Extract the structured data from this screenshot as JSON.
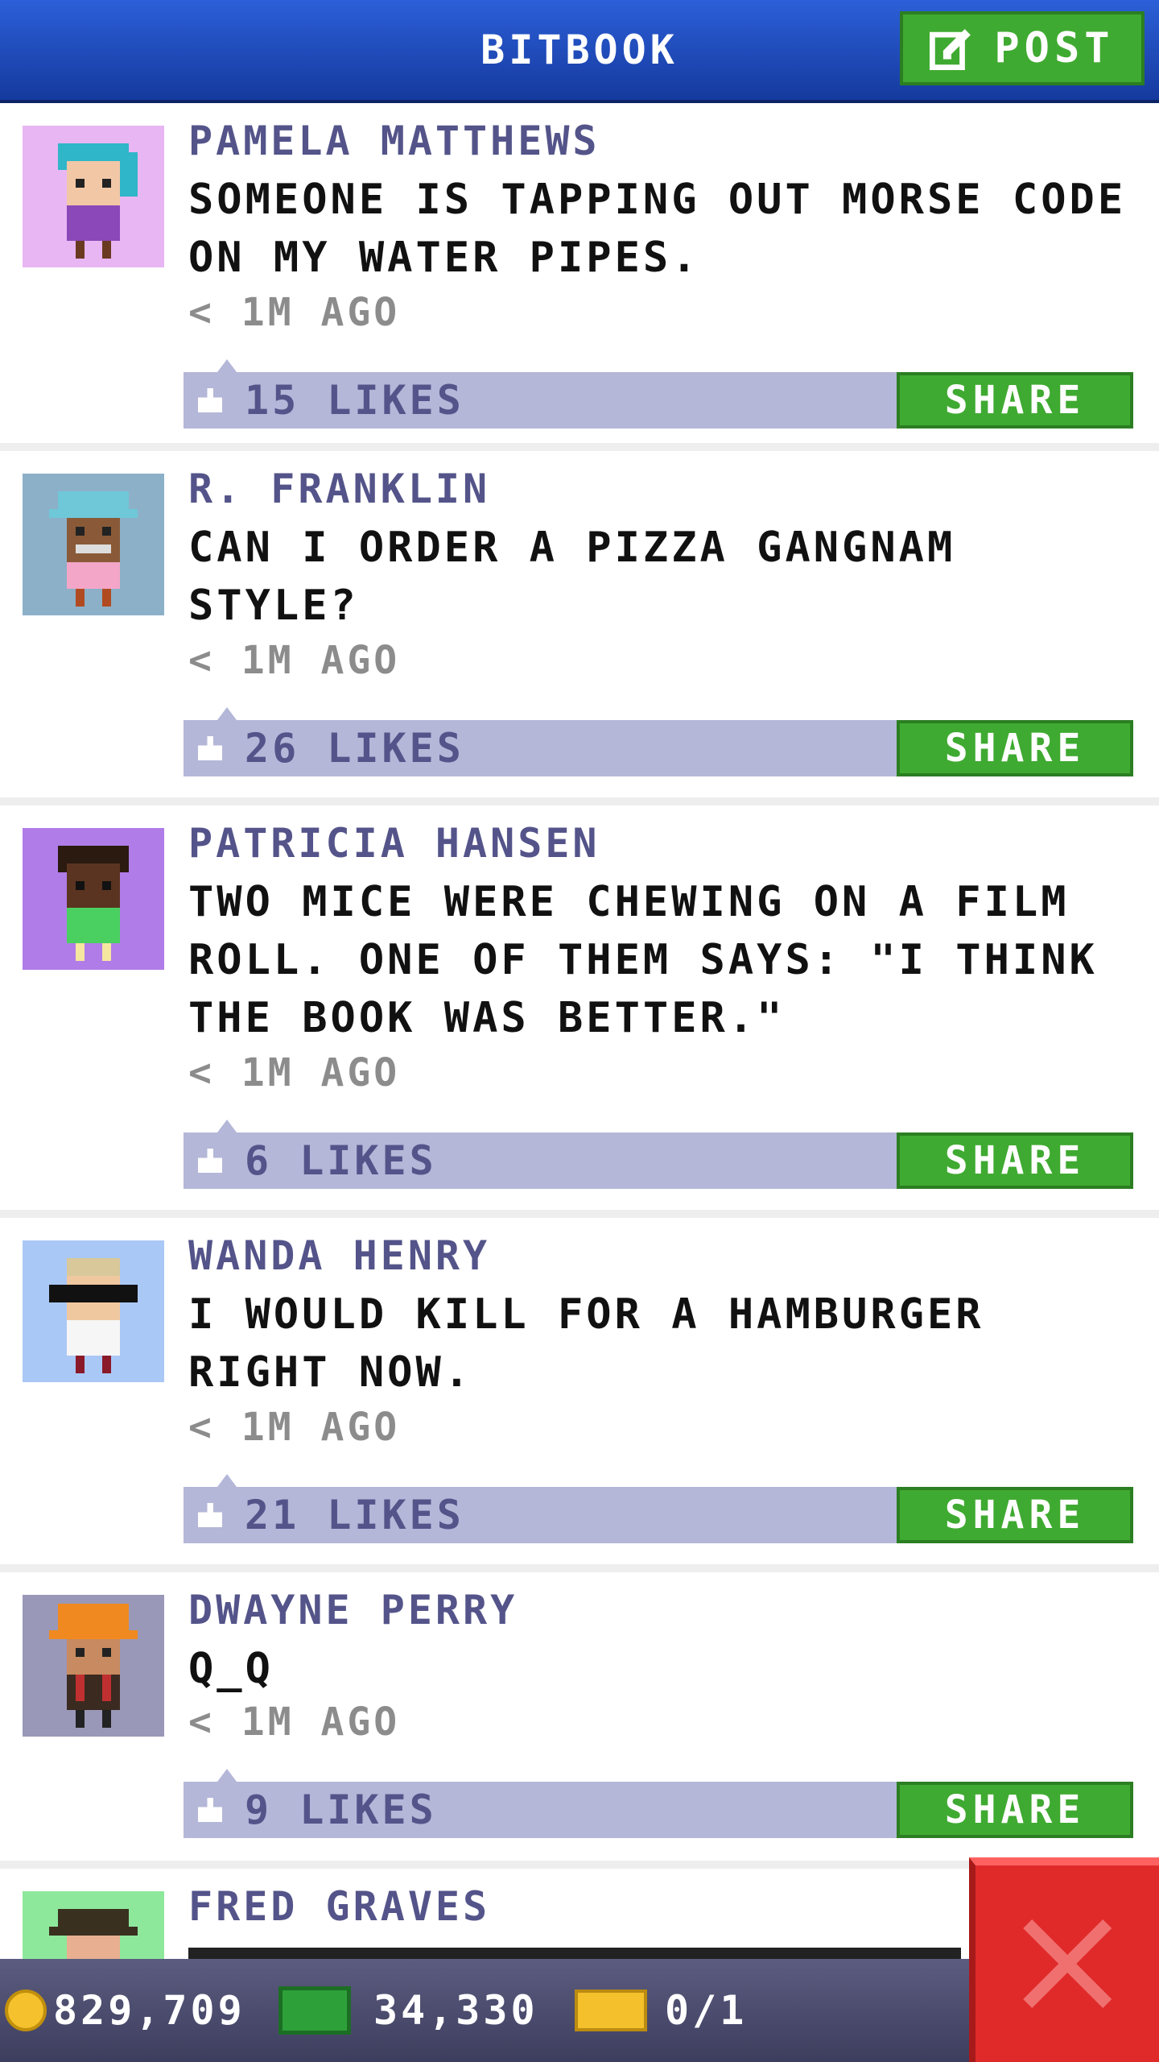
{
  "header": {
    "title": "BITBOOK",
    "post_label": "POST"
  },
  "share_label": "SHARE",
  "posts": [
    {
      "name": "PAMELA MATTHEWS",
      "text": "SOMEONE IS TAPPING OUT MORSE CODE ON MY WATER PIPES.",
      "time": "< 1M AGO",
      "likes": "15 LIKES",
      "avatar_bg": "#e8b6f3"
    },
    {
      "name": "R. FRANKLIN",
      "text": "CAN I ORDER A PIZZA GANGNAM STYLE?",
      "time": "< 1M AGO",
      "likes": "26 LIKES",
      "avatar_bg": "#8cb0c8"
    },
    {
      "name": "PATRICIA HANSEN",
      "text": "TWO MICE WERE CHEWING ON A FILM ROLL. ONE OF THEM SAYS: \"I THINK THE BOOK WAS BETTER.\"",
      "time": "< 1M AGO",
      "likes": "6 LIKES",
      "avatar_bg": "#b07ce8"
    },
    {
      "name": "WANDA HENRY",
      "text": "I WOULD KILL FOR A HAMBURGER RIGHT NOW.",
      "time": "< 1M AGO",
      "likes": "21 LIKES",
      "avatar_bg": "#aac8f6"
    },
    {
      "name": "DWAYNE PERRY",
      "text": "Q_Q",
      "time": "< 1M AGO",
      "likes": "9 LIKES",
      "avatar_bg": "#9a98b8"
    },
    {
      "name": "FRED GRAVES",
      "avatar_bg": "#8ee89c"
    }
  ],
  "bottom": {
    "coins": "829,709",
    "bux": "34,330",
    "tickets": "0/1"
  },
  "colors": {
    "header": "#2c5fd8",
    "green": "#3faa31",
    "like_bar": "#b4b7d8",
    "close": "#e02a2a"
  }
}
